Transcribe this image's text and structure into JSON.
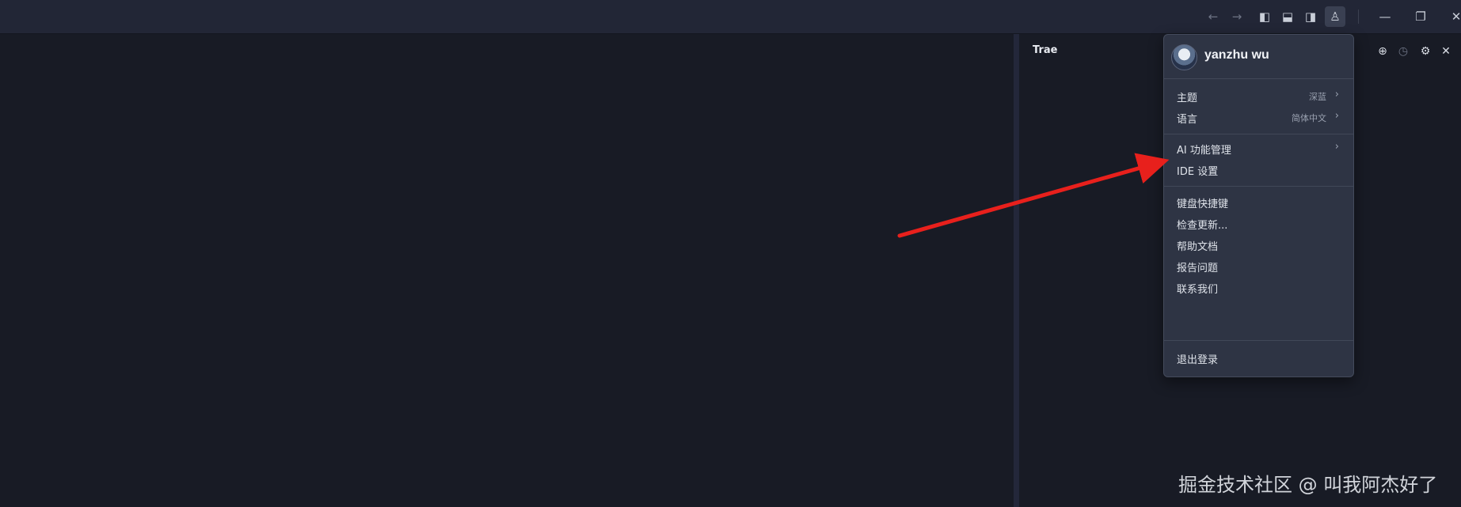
{
  "titlebar": {
    "icons": [
      {
        "name": "back-arrow-icon",
        "glyph": "←"
      },
      {
        "name": "forward-arrow-icon",
        "glyph": "→"
      },
      {
        "name": "toggle-left-sidebar-icon",
        "glyph": "◧"
      },
      {
        "name": "toggle-bottom-panel-icon",
        "glyph": "⬓"
      },
      {
        "name": "toggle-right-sidebar-icon",
        "glyph": "◨"
      },
      {
        "name": "account-icon",
        "glyph": "♙"
      }
    ],
    "window_controls": {
      "minimize": "—",
      "restore": "❐",
      "close": "✕"
    }
  },
  "panel": {
    "title": "Trae",
    "icons": {
      "new_chat": "⊕",
      "history": "◷",
      "settings": "⚙",
      "close": "✕"
    }
  },
  "menu": {
    "username": "yanzhu wu",
    "groups": [
      [
        {
          "label": "主题",
          "value": "深蓝",
          "chevron": "›"
        },
        {
          "label": "语言",
          "value": "简体中文",
          "chevron": "›"
        }
      ],
      [
        {
          "label": "AI 功能管理",
          "value": "",
          "chevron": "›"
        },
        {
          "label": "IDE 设置",
          "value": "",
          "chevron": ""
        }
      ],
      [
        {
          "label": "键盘快捷键",
          "value": "",
          "chevron": ""
        },
        {
          "label": "检查更新...",
          "value": "",
          "chevron": ""
        },
        {
          "label": "帮助文档",
          "value": "",
          "chevron": ""
        },
        {
          "label": "报告问题",
          "value": "",
          "chevron": ""
        },
        {
          "label": "联系我们",
          "value": "",
          "chevron": ""
        }
      ],
      [
        {
          "label": "退出登录",
          "value": "",
          "chevron": ""
        }
      ]
    ]
  },
  "annotation": {
    "arrow_color": "#e8201c"
  },
  "watermark": "掘金技术社区 @ 叫我阿杰好了",
  "colors": {
    "background": "#181b25",
    "titlebar": "#222636",
    "menu": "#2e3444"
  }
}
